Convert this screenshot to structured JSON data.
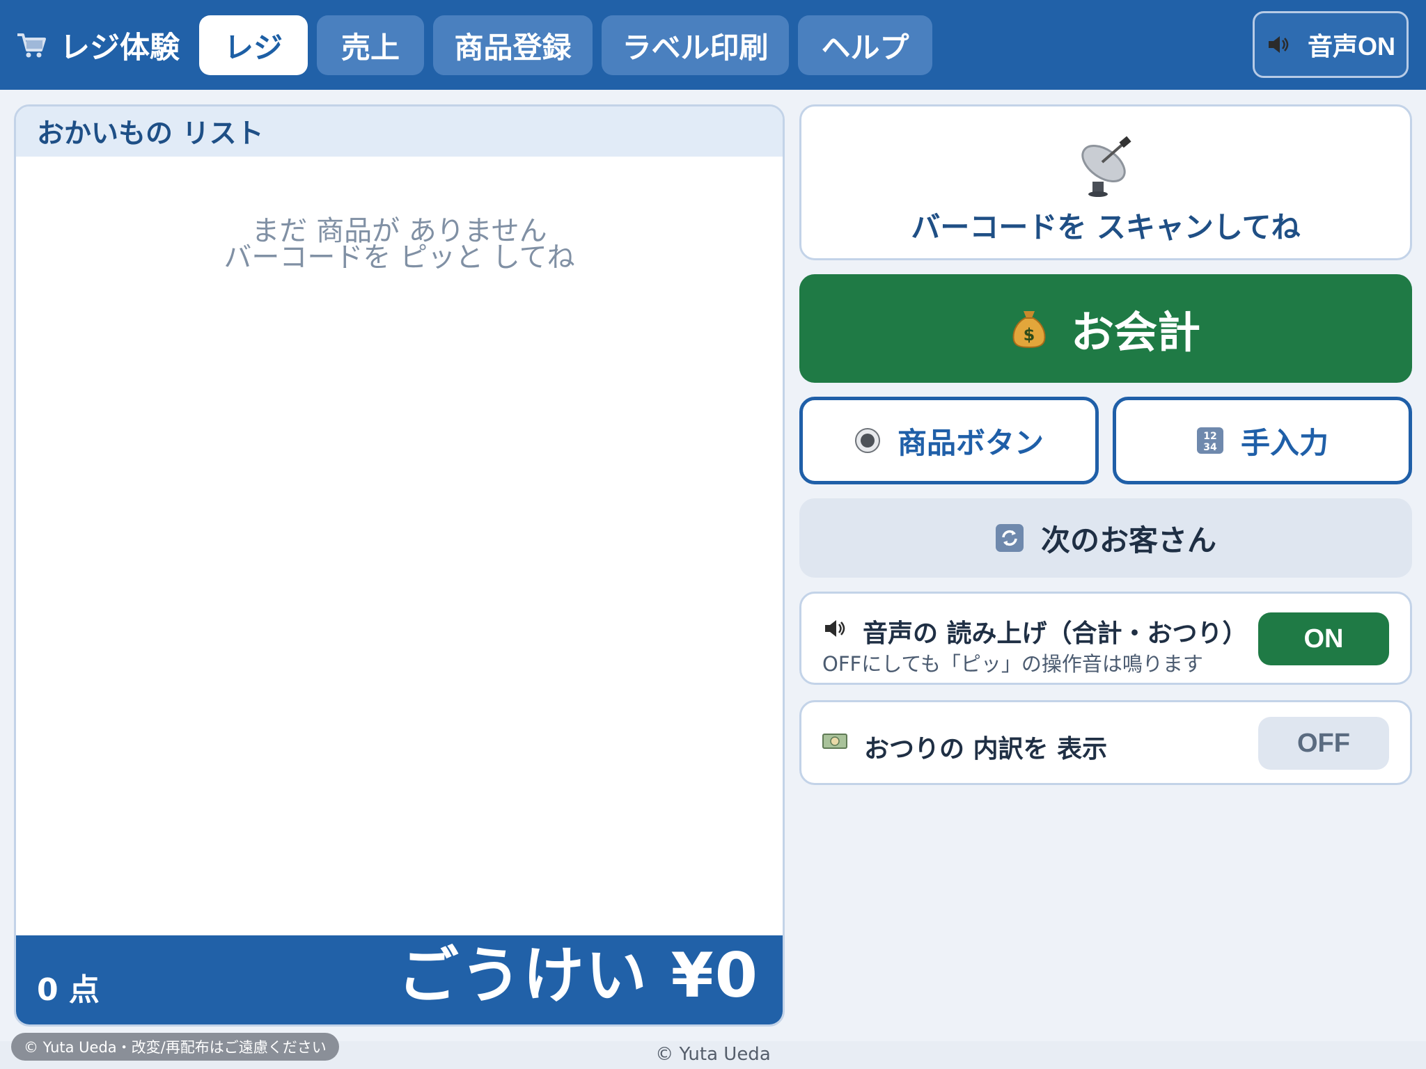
{
  "header": {
    "brand_icon": "cart-icon",
    "brand_title": "レジ体験",
    "tabs": [
      {
        "label": "レジ",
        "active": true
      },
      {
        "label": "売上",
        "active": false
      },
      {
        "label": "商品登録",
        "active": false
      },
      {
        "label": "ラベル印刷",
        "active": false
      },
      {
        "label": "ヘルプ",
        "active": false
      }
    ],
    "sound_button": {
      "icon": "speaker-icon",
      "label": "音声ON"
    }
  },
  "list": {
    "title": "おかいもの リスト",
    "empty_line1": "まだ 商品が ありません",
    "empty_line2": "バーコードを ピッと してね",
    "count": "0 点",
    "total": "ごうけい ¥0"
  },
  "scan": {
    "icon": "satellite-dish-icon",
    "text": "バーコードを スキャンしてね"
  },
  "checkout": {
    "icon": "money-bag-icon",
    "label": "お会計"
  },
  "product_button": {
    "icon": "radio-button-icon",
    "label": "商品ボタン"
  },
  "manual_input": {
    "icon": "numbers-icon",
    "label": "手入力"
  },
  "next_customer": {
    "icon": "refresh-icon",
    "label": "次のお客さん"
  },
  "voice_setting": {
    "icon": "speaker-icon",
    "title": "音声の 読み上げ（合計・おつり）",
    "subtitle": "OFFにしても「ピッ」の操作音は鳴ります",
    "toggle": "ON"
  },
  "change_setting": {
    "icon": "banknote-icon",
    "title": "おつりの 内訳を 表示",
    "toggle": "OFF"
  },
  "footer": {
    "badge": "© Yuta Ueda・改変/再配布はご遠慮ください",
    "center": "© Yuta Ueda"
  },
  "colors": {
    "header_blue": "#2161a8",
    "checkout_green": "#1f7a45",
    "background": "#eef2f8"
  }
}
